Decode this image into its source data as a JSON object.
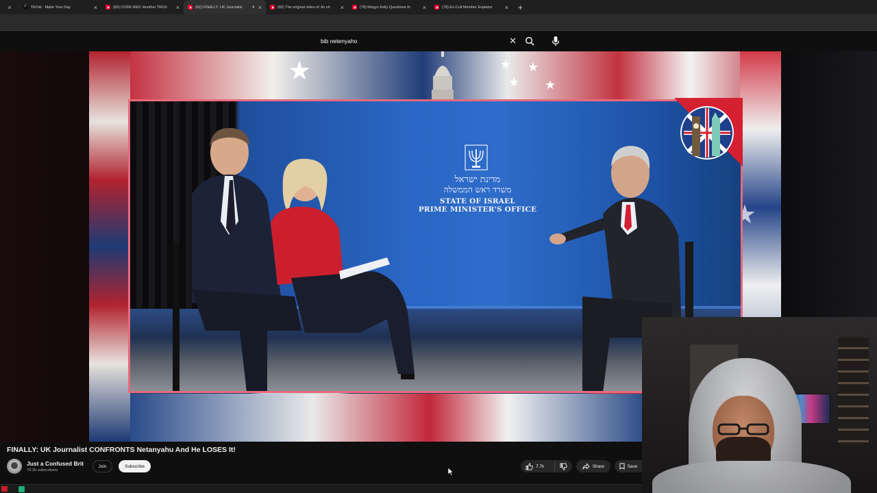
{
  "browser": {
    "tabs": [
      {
        "title": "TikTok - Make Your Day",
        "favicon": "tiktok",
        "active": false
      },
      {
        "title": "(82) CODE RED: Another TRUS",
        "favicon": "youtube",
        "active": false
      },
      {
        "title": "(82) FINALLY: UK Journalist",
        "favicon": "youtube",
        "active": true,
        "audio": true
      },
      {
        "title": "(82) The original video of Jin sh",
        "favicon": "youtube",
        "active": false
      },
      {
        "title": "(78) Megyn Kelly Questions th",
        "favicon": "youtube",
        "active": false
      },
      {
        "title": "(78) Ex-Cult Member Explains",
        "favicon": "youtube",
        "active": false
      }
    ],
    "close_glyph": "×",
    "new_tab_glyph": "+"
  },
  "search": {
    "query": "bib netenyaho",
    "clear_glyph": "✕"
  },
  "video_frame": {
    "hebrew_line1": "מדינת ישראל",
    "hebrew_line2": "משרד ראש הממשלה",
    "office_line1": "STATE OF ISRAEL",
    "office_line2": "PRIME MINISTER'S OFFICE"
  },
  "video": {
    "title": "FINALLY: UK Journalist CONFRONTS Netanyahu And He LOSES It!",
    "channel": "Just a Confused Brit",
    "subscribers": "79.2k subscribers",
    "join_label": "Join",
    "subscribe_label": "Subscribe",
    "likes": "7.7k",
    "share_label": "Share",
    "save_label": "Save"
  },
  "colors": {
    "youtube_red": "#ff0033",
    "frame_border": "#e86a7c",
    "background": "#0f0f0f"
  }
}
